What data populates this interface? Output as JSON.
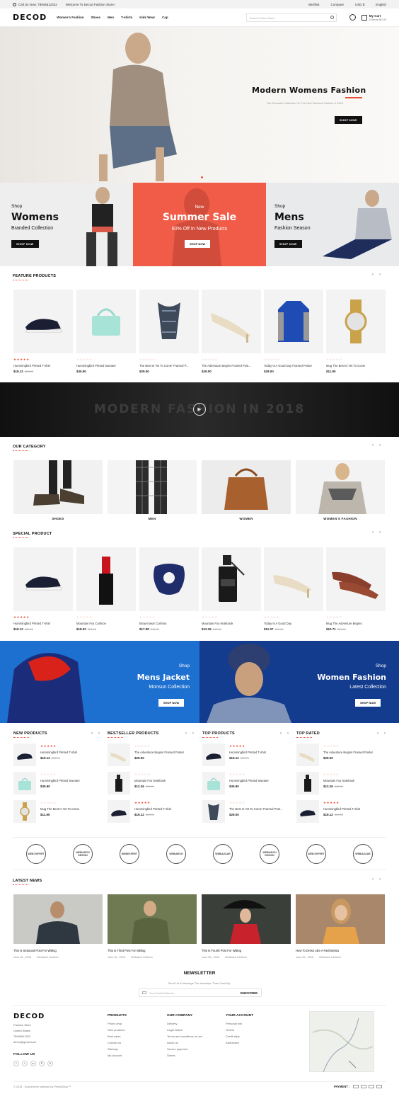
{
  "topbar": {
    "call": "Call Us Now: 78945612322",
    "welcome": "Welcome To Decod Fashion Store !",
    "wishlist": "Wishlist",
    "compare": "Compare",
    "currency": "USD $",
    "language": "English"
  },
  "header": {
    "logo": "DECOD",
    "nav": [
      "Women's Fashion",
      "Shoes",
      "Men",
      "T-shirts",
      "Kids Wear",
      "Cap"
    ],
    "search_placeholder": "Search Entire Store...",
    "cart_label": "My Cart",
    "cart_items": "0 Items $0.00"
  },
  "hero": {
    "title": "Modern Womens Fashion",
    "subtitle": "The Exclusive Collection On The New Womens Fashion In 2018",
    "button": "SHOP NOW"
  },
  "banners": [
    {
      "kicker": "Shop",
      "title": "Womens",
      "sub": "Branded Collection",
      "button": "SHOP NOW"
    },
    {
      "kicker": "New",
      "title": "Summer Sale",
      "sub": "60% Off In New Products",
      "button": "SHOP NOW"
    },
    {
      "kicker": "Shop",
      "title": "Mens",
      "sub": "Fashion Season",
      "button": "SHOP NOW"
    }
  ],
  "feature": {
    "title": "FEATURE PRODUCTS",
    "products": [
      {
        "name": "Hummingbird Printed T-shirt",
        "price": "$19.12",
        "old": "$23.90",
        "rated": true
      },
      {
        "name": "Hummingbird Printed Sweater",
        "price": "$35.90",
        "old": "",
        "rated": false
      },
      {
        "name": "The Best Is Yet To Come' Framed P...",
        "price": "$29.00",
        "old": "",
        "rated": false
      },
      {
        "name": "The Adventure Begins Framed Post...",
        "price": "$29.00",
        "old": "",
        "rated": false
      },
      {
        "name": "Today Is A Good Day Framed Poster",
        "price": "$29.00",
        "old": "",
        "rated": false
      },
      {
        "name": "Mug The Best Is Yet To Come",
        "price": "$11.90",
        "old": "",
        "rated": false
      }
    ]
  },
  "video": {
    "text": "MODERN FASHION IN 2018"
  },
  "category": {
    "title": "OUR CATEGORY",
    "items": [
      "SHOES",
      "MEN",
      "WOMEN",
      "WOMEN'S FASHION"
    ]
  },
  "special": {
    "title": "SPECIAL PRODUCT",
    "products": [
      {
        "name": "Hummingbird Printed T-shirt",
        "price": "$19.12",
        "old": "$23.90",
        "rated": true
      },
      {
        "name": "Mountain Fox Cushion",
        "price": "$18.52",
        "old": "$23.15",
        "rated": false
      },
      {
        "name": "Brown Bear Cushion",
        "price": "$17.98",
        "old": "$18.90",
        "rated": false
      },
      {
        "name": "Mountain Fox Notebook",
        "price": "$12.26",
        "old": "$12.90",
        "rated": false
      },
      {
        "name": "Today Is A Good Day",
        "price": "$11.07",
        "old": "$11.90",
        "rated": false
      },
      {
        "name": "Mug The Adventure Begins",
        "price": "$10.71",
        "old": "$11.90",
        "rated": false
      }
    ]
  },
  "promo": [
    {
      "kicker": "Shop",
      "title": "Mens Jacket",
      "sub": "Monsun Collection",
      "button": "SHOP NOW"
    },
    {
      "kicker": "Shop",
      "title": "Women Fashion",
      "sub": "Latest Collection",
      "button": "SHOP NOW"
    }
  ],
  "lists": [
    {
      "title": "NEW PRODUCTS",
      "items": [
        {
          "name": "Hummingbird Printed T-shirt",
          "price": "$19.12",
          "old": "$23.90",
          "rated": true
        },
        {
          "name": "Hummingbird Printed Sweater",
          "price": "$35.90",
          "old": "",
          "rated": false
        },
        {
          "name": "Mug The Best Is Yet To Come",
          "price": "$11.90",
          "old": "",
          "rated": false
        }
      ]
    },
    {
      "title": "BESTSELLER PRODUCTS",
      "items": [
        {
          "name": "The Adventure Begins Framed Poster",
          "price": "$29.00",
          "old": "",
          "rated": false
        },
        {
          "name": "Mountain Fox Notebook",
          "price": "$12.26",
          "old": "$12.90",
          "rated": false
        },
        {
          "name": "Hummingbird Printed T-shirt",
          "price": "$19.12",
          "old": "$23.90",
          "rated": true
        }
      ]
    },
    {
      "title": "TOP PRODUCTS",
      "items": [
        {
          "name": "Hummingbird Printed T-shirt",
          "price": "$19.12",
          "old": "$23.90",
          "rated": true
        },
        {
          "name": "Hummingbird Printed Sweater",
          "price": "$35.90",
          "old": "",
          "rated": false
        },
        {
          "name": "The Best Is Yet To Come' Framed Post...",
          "price": "$29.00",
          "old": "",
          "rated": false
        }
      ]
    },
    {
      "title": "TOP RATED",
      "items": [
        {
          "name": "The Adventure Begins Framed Poster",
          "price": "$29.00",
          "old": "",
          "rated": false
        },
        {
          "name": "Mountain Fox Notebook",
          "price": "$12.26",
          "old": "$12.90",
          "rated": false
        },
        {
          "name": "Hummingbird Printed T-shirt",
          "price": "$19.12",
          "old": "$23.90",
          "rated": true
        }
      ]
    }
  ],
  "brands": [
    "WEB EXPERT",
    "WEBIARCH DESIGN",
    "WEBEXPERT",
    "WEBIARCH",
    "WEBIAZAAR",
    "WEBIARCH DESIGN",
    "WEB EXPERT",
    "WEBIAZAAR"
  ],
  "blog": {
    "title": "LATEST NEWS",
    "author": "Webiarch Infotech",
    "posts": [
      {
        "title": "This Is Sedound Post For WBlog",
        "date": "June 06 , 2018"
      },
      {
        "title": "This Is Third Post For WBlog",
        "date": "June 06 , 2018"
      },
      {
        "title": "This Is Fourth Post For WBlog",
        "date": "June 06 , 2018"
      },
      {
        "title": "How To Dress Like A Fashionista",
        "date": "June 06 , 2018"
      }
    ]
  },
  "newsletter": {
    "title": "NEWSLETTER",
    "text": "Send Us A Message The Industrys Than Card My.",
    "placeholder": "Your Email Address",
    "button": "SUBSCRIBE"
  },
  "footer": {
    "logo": "DECOD",
    "store": [
      "Fashion Store",
      "United States",
      "78945612322",
      "demo@gmail.com"
    ],
    "follow": "FOLLOW US",
    "social": [
      "f",
      "t",
      "G+",
      "P",
      "V"
    ],
    "cols": [
      {
        "title": "PRODUCTS",
        "links": [
          "Prices drop",
          "New products",
          "Best sales",
          "Contact us",
          "Sitemap",
          "My account"
        ]
      },
      {
        "title": "OUR COMPANY",
        "links": [
          "Delivery",
          "Legal Notice",
          "Terms and conditions of use",
          "About us",
          "Secure payment",
          "Stores"
        ]
      },
      {
        "title": "YOUR ACCOUNT",
        "links": [
          "Personal info",
          "Orders",
          "Credit slips",
          "Addresses"
        ]
      }
    ],
    "copyright": "© 2018 - Ecommerce software by PrestaShop™",
    "payment": "PAYMENT :"
  },
  "colors": {
    "accent": "#e8503a",
    "dark": "#111111",
    "blue": "#1e63c4"
  }
}
